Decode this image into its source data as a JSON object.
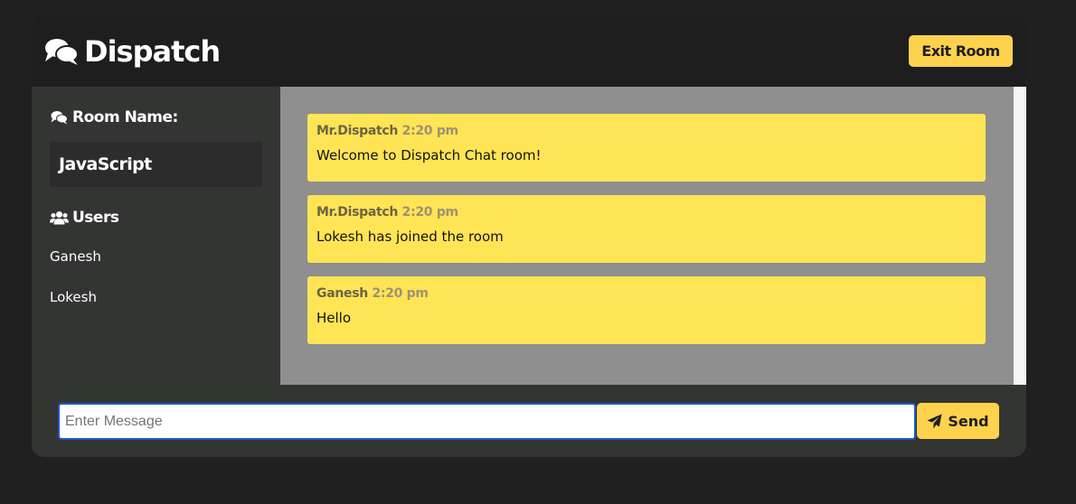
{
  "header": {
    "title": "Dispatch",
    "brand_icon": "comments-icon",
    "exit_label": "Exit Room"
  },
  "sidebar": {
    "room_heading": "Room Name:",
    "room_heading_icon": "comments-icon",
    "room_name": "JavaScript",
    "users_heading": "Users",
    "users_heading_icon": "users-icon",
    "users": [
      "Ganesh",
      "Lokesh"
    ]
  },
  "messages": [
    {
      "author": "Mr.Dispatch",
      "time": "2:20 pm",
      "text": "Welcome to Dispatch Chat room!"
    },
    {
      "author": "Mr.Dispatch",
      "time": "2:20 pm",
      "text": "Lokesh has joined the room"
    },
    {
      "author": "Ganesh",
      "time": "2:20 pm",
      "text": "Hello"
    }
  ],
  "composer": {
    "placeholder": "Enter Message",
    "value": "",
    "send_label": "Send",
    "send_icon": "paper-plane-icon"
  },
  "colors": {
    "accent": "#ffd24d",
    "message_bg": "#ffe455",
    "header_bg": "#1f1e1f",
    "panel_bg": "#333533",
    "messages_bg": "#8f8f8f"
  }
}
